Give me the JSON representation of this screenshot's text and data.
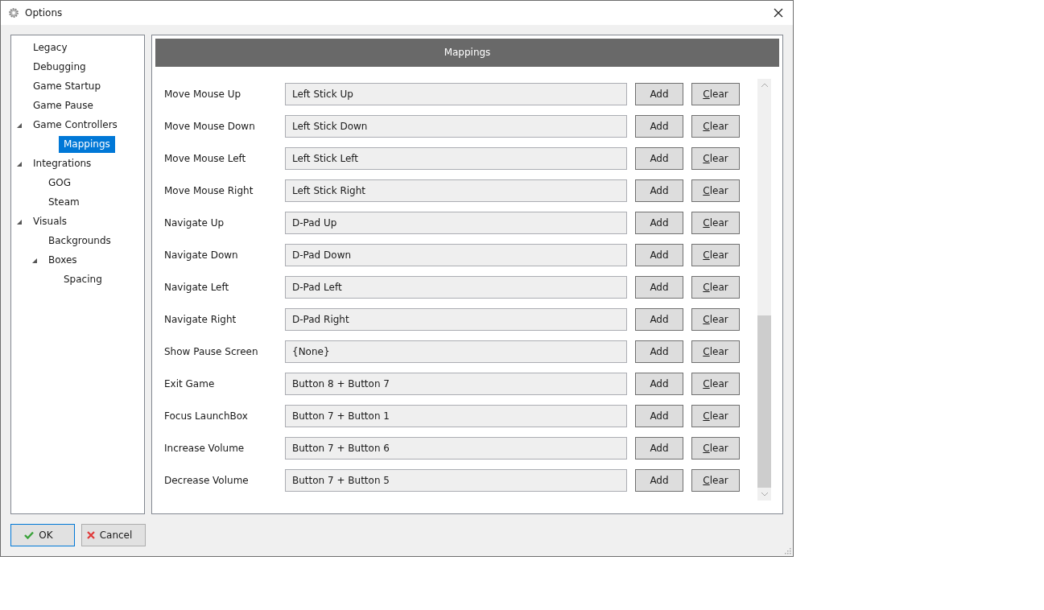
{
  "window": {
    "title": "Options"
  },
  "sidebar": {
    "items": [
      {
        "label": "Legacy",
        "selected": false
      },
      {
        "label": "Debugging",
        "selected": false
      },
      {
        "label": "Game Startup",
        "selected": false
      },
      {
        "label": "Game Pause",
        "selected": false
      },
      {
        "label": "Game Controllers",
        "selected": false,
        "expanded": true,
        "children": [
          {
            "label": "Mappings",
            "selected": true
          }
        ]
      },
      {
        "label": "Integrations",
        "selected": false,
        "expanded": true,
        "children": [
          {
            "label": "GOG",
            "selected": false
          },
          {
            "label": "Steam",
            "selected": false
          }
        ]
      },
      {
        "label": "Visuals",
        "selected": false,
        "expanded": true,
        "children": [
          {
            "label": "Backgrounds",
            "selected": false
          },
          {
            "label": "Boxes",
            "selected": false,
            "expanded": true,
            "children": [
              {
                "label": "Spacing",
                "selected": false
              }
            ]
          }
        ]
      }
    ]
  },
  "panel": {
    "title": "Mappings",
    "rows": [
      {
        "label": "Move Mouse Up",
        "value": "Left Stick Up",
        "add": "Add",
        "clear": "Clear"
      },
      {
        "label": "Move Mouse Down",
        "value": "Left Stick Down",
        "add": "Add",
        "clear": "Clear"
      },
      {
        "label": "Move Mouse Left",
        "value": "Left Stick Left",
        "add": "Add",
        "clear": "Clear"
      },
      {
        "label": "Move Mouse Right",
        "value": "Left Stick Right",
        "add": "Add",
        "clear": "Clear"
      },
      {
        "label": "Navigate Up",
        "value": "D-Pad Up",
        "add": "Add",
        "clear": "Clear"
      },
      {
        "label": "Navigate Down",
        "value": "D-Pad Down",
        "add": "Add",
        "clear": "Clear"
      },
      {
        "label": "Navigate Left",
        "value": "D-Pad Left",
        "add": "Add",
        "clear": "Clear"
      },
      {
        "label": "Navigate Right",
        "value": "D-Pad Right",
        "add": "Add",
        "clear": "Clear"
      },
      {
        "label": "Show Pause Screen",
        "value": "{None}",
        "add": "Add",
        "clear": "Clear"
      },
      {
        "label": "Exit Game",
        "value": "Button 8 + Button 7",
        "add": "Add",
        "clear": "Clear"
      },
      {
        "label": "Focus LaunchBox",
        "value": "Button 7 + Button 1",
        "add": "Add",
        "clear": "Clear"
      },
      {
        "label": "Increase Volume",
        "value": "Button 7 + Button 6",
        "add": "Add",
        "clear": "Clear"
      },
      {
        "label": "Decrease Volume",
        "value": "Button 7 + Button 5",
        "add": "Add",
        "clear": "Clear"
      }
    ]
  },
  "buttons": [
    {
      "kind": "ok",
      "label": "OK"
    },
    {
      "kind": "cancel",
      "label": "Cancel"
    }
  ]
}
